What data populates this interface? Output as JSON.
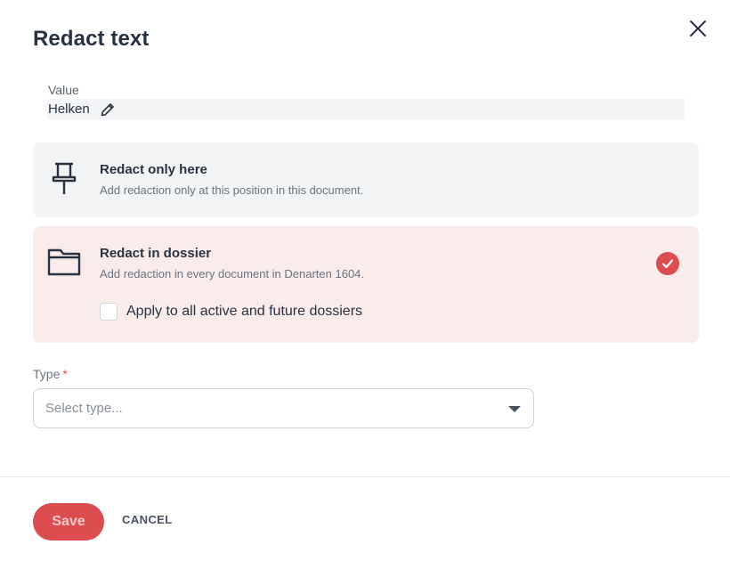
{
  "dialog": {
    "title": "Redact text",
    "close_icon": "close-icon"
  },
  "value": {
    "label": "Value",
    "text": "Helken",
    "edit_icon": "pencil-icon"
  },
  "options": {
    "only_here": {
      "icon": "pushpin-icon",
      "title": "Redact only here",
      "description": "Add redaction only at this position in this document.",
      "selected": false
    },
    "in_dossier": {
      "icon": "folder-icon",
      "title": "Redact in dossier",
      "description": "Add redaction in every document in Denarten 1604.",
      "selected": true,
      "apply_all_label": "Apply to all active and future dossiers",
      "apply_all_checked": false
    }
  },
  "type_field": {
    "label": "Type",
    "required_mark": "*",
    "placeholder": "Select type..."
  },
  "footer": {
    "save_label": "Save",
    "cancel_label": "CANCEL"
  },
  "colors": {
    "accent": "#dd4d50",
    "selected_bg": "#faeceb",
    "option_bg": "#f3f4f6",
    "text": "#283241"
  }
}
